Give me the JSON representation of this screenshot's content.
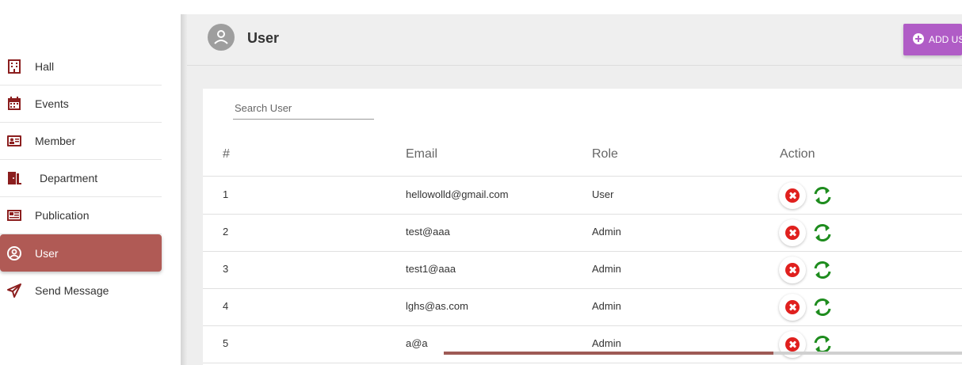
{
  "colors": {
    "active_nav": "#b05a55",
    "add_button": "#b05cc6",
    "delete_icon": "#e0201e",
    "reset_icon": "#1e8c1e"
  },
  "sidebar": {
    "items": [
      {
        "label": "Hall",
        "icon": "building-icon"
      },
      {
        "label": "Events",
        "icon": "calendar-icon"
      },
      {
        "label": "Member",
        "icon": "id-card-icon"
      },
      {
        "label": "Department",
        "icon": "door-icon"
      },
      {
        "label": "Publication",
        "icon": "newspaper-icon"
      },
      {
        "label": "User",
        "icon": "user-circle-icon",
        "active": true
      },
      {
        "label": "Send Message",
        "icon": "paper-plane-icon"
      }
    ]
  },
  "header": {
    "title": "User",
    "add_button": "ADD US"
  },
  "search": {
    "placeholder": "Search User"
  },
  "table": {
    "columns": [
      "#",
      "Email",
      "Role",
      "Action"
    ],
    "rows": [
      {
        "num": "1",
        "email": "hellowolld@gmail.com",
        "role": "User"
      },
      {
        "num": "2",
        "email": "test@aaa",
        "role": "Admin"
      },
      {
        "num": "3",
        "email": "test1@aaa",
        "role": "Admin"
      },
      {
        "num": "4",
        "email": "lghs@as.com",
        "role": "Admin"
      },
      {
        "num": "5",
        "email": "a@a",
        "role": "Admin"
      }
    ]
  }
}
